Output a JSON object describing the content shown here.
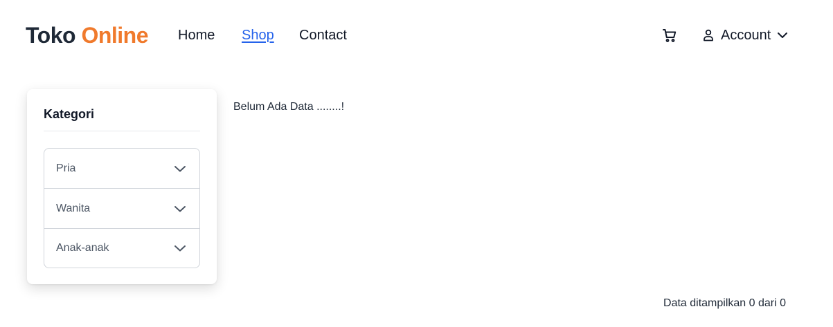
{
  "brand": {
    "part1": "Toko",
    "part2": "Online"
  },
  "nav": {
    "home": "Home",
    "shop": "Shop",
    "contact": "Contact"
  },
  "header": {
    "cart_icon": "cart-icon",
    "account_icon": "user-icon",
    "account_label": "Account",
    "account_chevron_icon": "chevron-down-icon"
  },
  "sidebar": {
    "title": "Kategori",
    "items": [
      {
        "label": "Pria"
      },
      {
        "label": "Wanita"
      },
      {
        "label": "Anak-anak"
      }
    ]
  },
  "main": {
    "empty_message": "Belum Ada Data ........!",
    "count_text": "Data ditampilkan 0 dari 0"
  },
  "colors": {
    "brand_accent": "#f07a2c",
    "active_link": "#2563eb"
  }
}
